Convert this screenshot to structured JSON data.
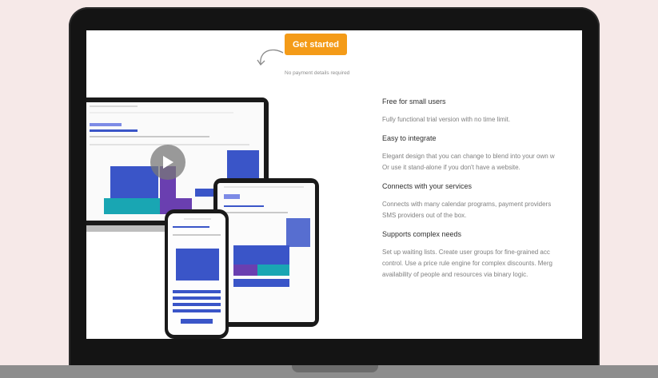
{
  "cta": {
    "get_started_label": "Get started",
    "no_payment_note": "No payment details required"
  },
  "features": [
    {
      "title": "Free for small users",
      "lines": [
        "Fully functional trial version with no time limit."
      ]
    },
    {
      "title": "Easy to integrate",
      "lines": [
        "Elegant design that you can change to blend into your own w",
        "Or use it stand-alone if you don't have a website."
      ]
    },
    {
      "title": "Connects with your services",
      "lines": [
        "Connects with many calendar programs, payment providers",
        "SMS providers out of the box."
      ]
    },
    {
      "title": "Supports complex needs",
      "lines": [
        "Set up waiting lists. Create user groups for fine-grained acc",
        "control. Use a price rule engine for complex discounts. Merg",
        "availability of people and resources via binary logic."
      ]
    }
  ],
  "colors": {
    "background": "#f6e9e8",
    "accent": "#f49b18",
    "calendar_blue": "#3a55c8",
    "calendar_purple": "#6a3fb0",
    "calendar_teal": "#19a6b3"
  },
  "icons": [
    "play-icon",
    "curved-arrow-icon"
  ]
}
